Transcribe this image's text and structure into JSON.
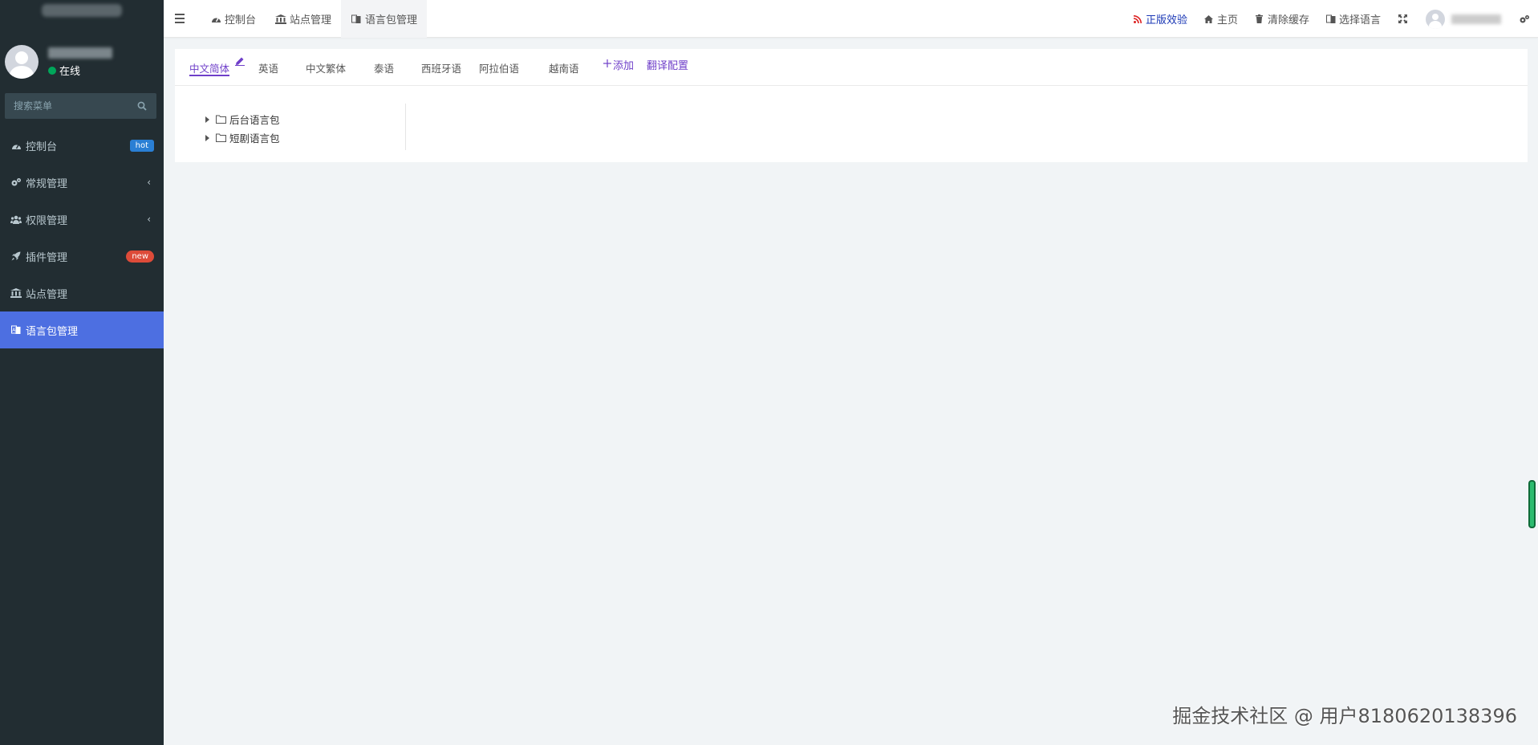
{
  "sidebar": {
    "status": "在线",
    "search_placeholder": "搜索菜单",
    "items": [
      {
        "label": "控制台",
        "badge": "hot"
      },
      {
        "label": "常规管理"
      },
      {
        "label": "权限管理"
      },
      {
        "label": "插件管理",
        "badge": "new"
      },
      {
        "label": "站点管理"
      },
      {
        "label": "语言包管理"
      }
    ]
  },
  "topbar": {
    "tabs": [
      {
        "label": "控制台"
      },
      {
        "label": "站点管理"
      },
      {
        "label": "语言包管理"
      }
    ],
    "right": {
      "promo": "正版效验",
      "home": "主页",
      "clear_cache": "清除缓存",
      "select_lang": "选择语言"
    }
  },
  "lang_tabs": [
    "中文简体",
    "英语",
    "中文繁体",
    "泰语",
    "西班牙语",
    "阿拉伯语",
    "越南语"
  ],
  "add_label": "添加",
  "translate_config": "翻译配置",
  "tree": [
    "后台语言包",
    "短剧语言包"
  ],
  "watermark": "掘金技术社区 @ 用户8180620138396",
  "colors": {
    "sidebar_bg": "#222d32",
    "active_menu": "#4d6fe1",
    "accent": "#6f3fc9",
    "promo_text": "#1a37b5"
  }
}
